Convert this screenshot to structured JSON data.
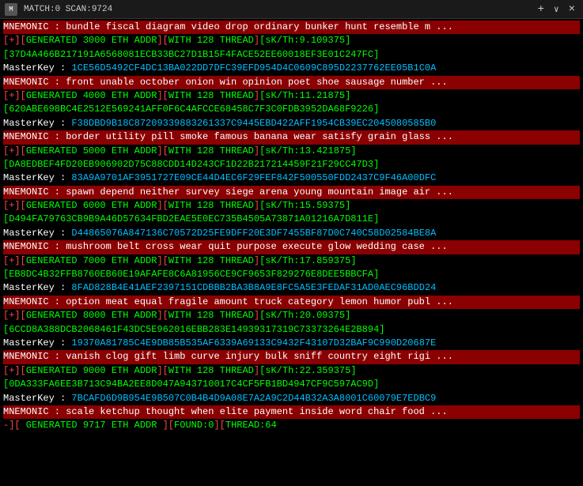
{
  "titleBar": {
    "icon": "M",
    "title": "MATCH:0 SCAN:9724",
    "close": "×",
    "plus": "+",
    "chevron": "∨"
  },
  "lines": [
    {
      "type": "mnemonic",
      "text": "MNEMONIC : bundle fiscal diagram video drop ordinary bunker hunt resemble m ..."
    },
    {
      "type": "generated",
      "prefix": "[+][GENERATED 3000 ETH ADDR][WITH 128 THREAD]",
      "suffix": "[sK/Th:9.109375]"
    },
    {
      "type": "addr",
      "text": "[37D4A466B217191A6568081ECB33BC27D1B15F4FACE52EE60018EF3E01C247FC]"
    },
    {
      "type": "masterkey",
      "label": "MasterKey : ",
      "value": "1CE56D5492CF4DC13BA022DD7DFC39EFD954D4C0609C895D2237762EE05B1C0A"
    },
    {
      "type": "mnemonic",
      "text": "MNEMONIC : front unable october onion win opinion poet shoe sausage number ..."
    },
    {
      "type": "generated",
      "prefix": "[+][GENERATED 4000 ETH ADDR][WITH 128 THREAD]",
      "suffix": "[sK/Th:11.21875]"
    },
    {
      "type": "addr",
      "text": "[620ABE698BC4E2512E569241AFF0F6C4AFCCE68458C7F3C0FDB3952DA68F9226]"
    },
    {
      "type": "masterkey",
      "label": "MasterKey : ",
      "value": "F38DBD9B18C87209339883261337C9445EBD422AFF1954CB39EC2045080585B0"
    },
    {
      "type": "mnemonic",
      "text": "MNEMONIC : border utility pill smoke famous banana wear satisfy grain glass ..."
    },
    {
      "type": "generated",
      "prefix": "[+][GENERATED 5000 ETH ADDR][WITH 128 THREAD]",
      "suffix": "[sK/Th:13.421875]"
    },
    {
      "type": "addr",
      "text": "[DA8EDBEF4FD20EB906902D75C88CDD14D243CF1D22B217214459F21F29CC47D3]"
    },
    {
      "type": "masterkey",
      "label": "MasterKey : ",
      "value": "83A9A9701AF3951727E09CE44D4EC6F29FEF842F500550FDD2437C9F46A00DFC"
    },
    {
      "type": "mnemonic",
      "text": "MNEMONIC : spawn depend neither survey siege arena young mountain image air ..."
    },
    {
      "type": "generated",
      "prefix": "[+][GENERATED 6000 ETH ADDR][WITH 128 THREAD]",
      "suffix": "[sK/Th:15.59375]"
    },
    {
      "type": "addr",
      "text": "[D494FA79763CB9B9A46D57634FBD2EAE5E0EC735B4505A73871A01216A7D811E]"
    },
    {
      "type": "masterkey",
      "label": "MasterKey : ",
      "value": "D44865076A847136C70572D25FE9DFF20E3DF7455BF87D0C740C58D02584BE8A"
    },
    {
      "type": "mnemonic",
      "text": "MNEMONIC : mushroom belt cross wear quit purpose execute glow wedding case ..."
    },
    {
      "type": "generated",
      "prefix": "[+][GENERATED 7000 ETH ADDR][WITH 128 THREAD]",
      "suffix": "[sK/Th:17.859375]"
    },
    {
      "type": "addr",
      "text": "[EB8DC4B32FFB8760EB60E19AFAFE8C6A81956CE9CF9653F829276E8DEE5BBCFA]"
    },
    {
      "type": "masterkey",
      "label": "MasterKey : ",
      "value": "8FAD828B4E41AEF2397151CDBBB2BA3B8A9E8FC5A5E3FEDAF31AD0AEC96BDD24"
    },
    {
      "type": "mnemonic",
      "text": "MNEMONIC : option meat equal fragile amount truck category lemon humor publ ..."
    },
    {
      "type": "generated",
      "prefix": "[+][GENERATED 8000 ETH ADDR][WITH 128 THREAD]",
      "suffix": "[sK/Th:20.09375]"
    },
    {
      "type": "addr",
      "text": "[6CCD8A388DCB2068461F43DC5E962016EBB283E14939317319C73373264E2B894]"
    },
    {
      "type": "masterkey",
      "label": "MasterKey : ",
      "value": "19370A81785C4E9DB85B535AF6339A69133C9432F43107D32BAF9C990D20687E"
    },
    {
      "type": "mnemonic",
      "text": "MNEMONIC : vanish clog gift limb curve injury bulk sniff country eight rigi ..."
    },
    {
      "type": "generated",
      "prefix": "[+][GENERATED 9000 ETH ADDR][WITH 128 THREAD]",
      "suffix": "[sK/Th:22.359375]"
    },
    {
      "type": "addr",
      "text": "[0DA333FA6EE3B713C94BA2EE8D047A943710017C4CF5FB1BD4947CF9C597AC9D]"
    },
    {
      "type": "masterkey",
      "label": "MasterKey : ",
      "value": "7BCAFD6D9B954E9B507C0B4B4D9A08E7A2A9C2D44B32A3A8001C60079E7EDBC9"
    },
    {
      "type": "mnemonic",
      "text": "MNEMONIC : scale ketchup thought when elite payment inside word chair food ..."
    },
    {
      "type": "status",
      "text": "-][ GENERATED 9717 ETH ADDR ][FOUND:0][THREAD:64"
    }
  ]
}
